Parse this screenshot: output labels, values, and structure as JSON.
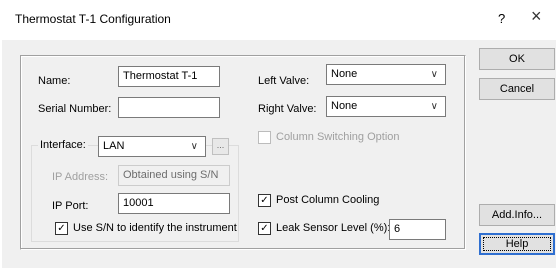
{
  "window": {
    "title": "Thermostat T-1 Configuration",
    "help_glyph": "?",
    "close_glyph": "×"
  },
  "fields": {
    "name_label": "Name:",
    "name_value": "Thermostat T-1",
    "serial_label": "Serial Number:",
    "serial_value": "",
    "interface_label": "Interface:",
    "interface_value": "LAN",
    "interface_more": "...",
    "ip_address_label": "IP Address:",
    "ip_address_value": "Obtained using S/N",
    "ip_port_label": "IP Port:",
    "ip_port_value": "10001",
    "use_sn_label": "Use S/N to identify the instrument",
    "use_sn_checked": "✓",
    "left_valve_label": "Left Valve:",
    "left_valve_value": "None",
    "right_valve_label": "Right Valve:",
    "right_valve_value": "None",
    "column_switching_label": "Column Switching Option",
    "post_column_label": "Post Column Cooling",
    "post_column_checked": "✓",
    "leak_sensor_label": "Leak Sensor Level (%):",
    "leak_sensor_checked": "✓",
    "leak_sensor_value": "6"
  },
  "buttons": {
    "ok": "OK",
    "cancel": "Cancel",
    "add_info": "Add.Info...",
    "help": "Help"
  },
  "icons": {
    "dropdown": "∨"
  }
}
